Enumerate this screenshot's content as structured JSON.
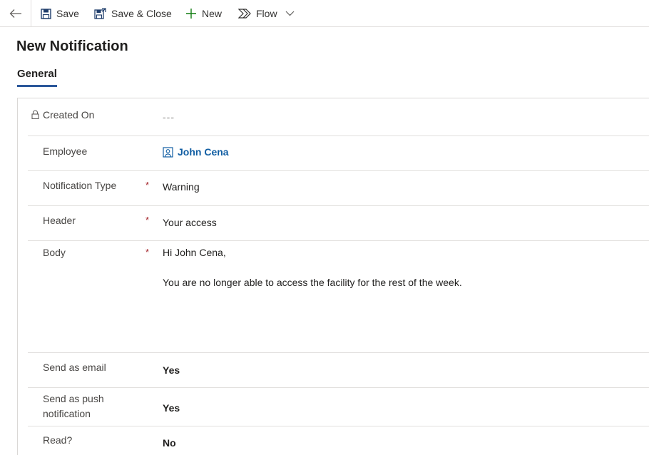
{
  "toolbar": {
    "save_label": "Save",
    "save_close_label": "Save & Close",
    "new_label": "New",
    "flow_label": "Flow"
  },
  "page": {
    "title": "New Notification",
    "tabs": [
      {
        "label": "General",
        "active": true
      }
    ]
  },
  "form": {
    "created_on": {
      "label": "Created On",
      "value": "---"
    },
    "employee": {
      "label": "Employee",
      "value": "John Cena"
    },
    "notification_type": {
      "label": "Notification Type",
      "required": "*",
      "value": "Warning"
    },
    "header": {
      "label": "Header",
      "required": "*",
      "value": "Your access"
    },
    "body": {
      "label": "Body",
      "required": "*",
      "line1": "Hi John Cena,",
      "line2": "You are no longer able to access the facility for the rest of the week."
    },
    "send_email": {
      "label": "Send as email",
      "value": "Yes"
    },
    "send_push": {
      "label_line1": "Send as push",
      "label_line2": "notification",
      "value": "Yes"
    },
    "read": {
      "label": "Read?",
      "value": "No"
    }
  },
  "colors": {
    "accent": "#2b579a",
    "link": "#115ea3",
    "required": "#a4262c",
    "border": "#e1dfdd"
  },
  "icons": {
    "back": "arrow-left-icon",
    "save": "floppy-disk-icon",
    "save_close": "save-and-close-icon",
    "new": "plus-icon",
    "flow": "flow-icon",
    "flow_menu": "chevron-down-icon",
    "lock": "lock-icon",
    "contact": "contact-card-icon"
  }
}
